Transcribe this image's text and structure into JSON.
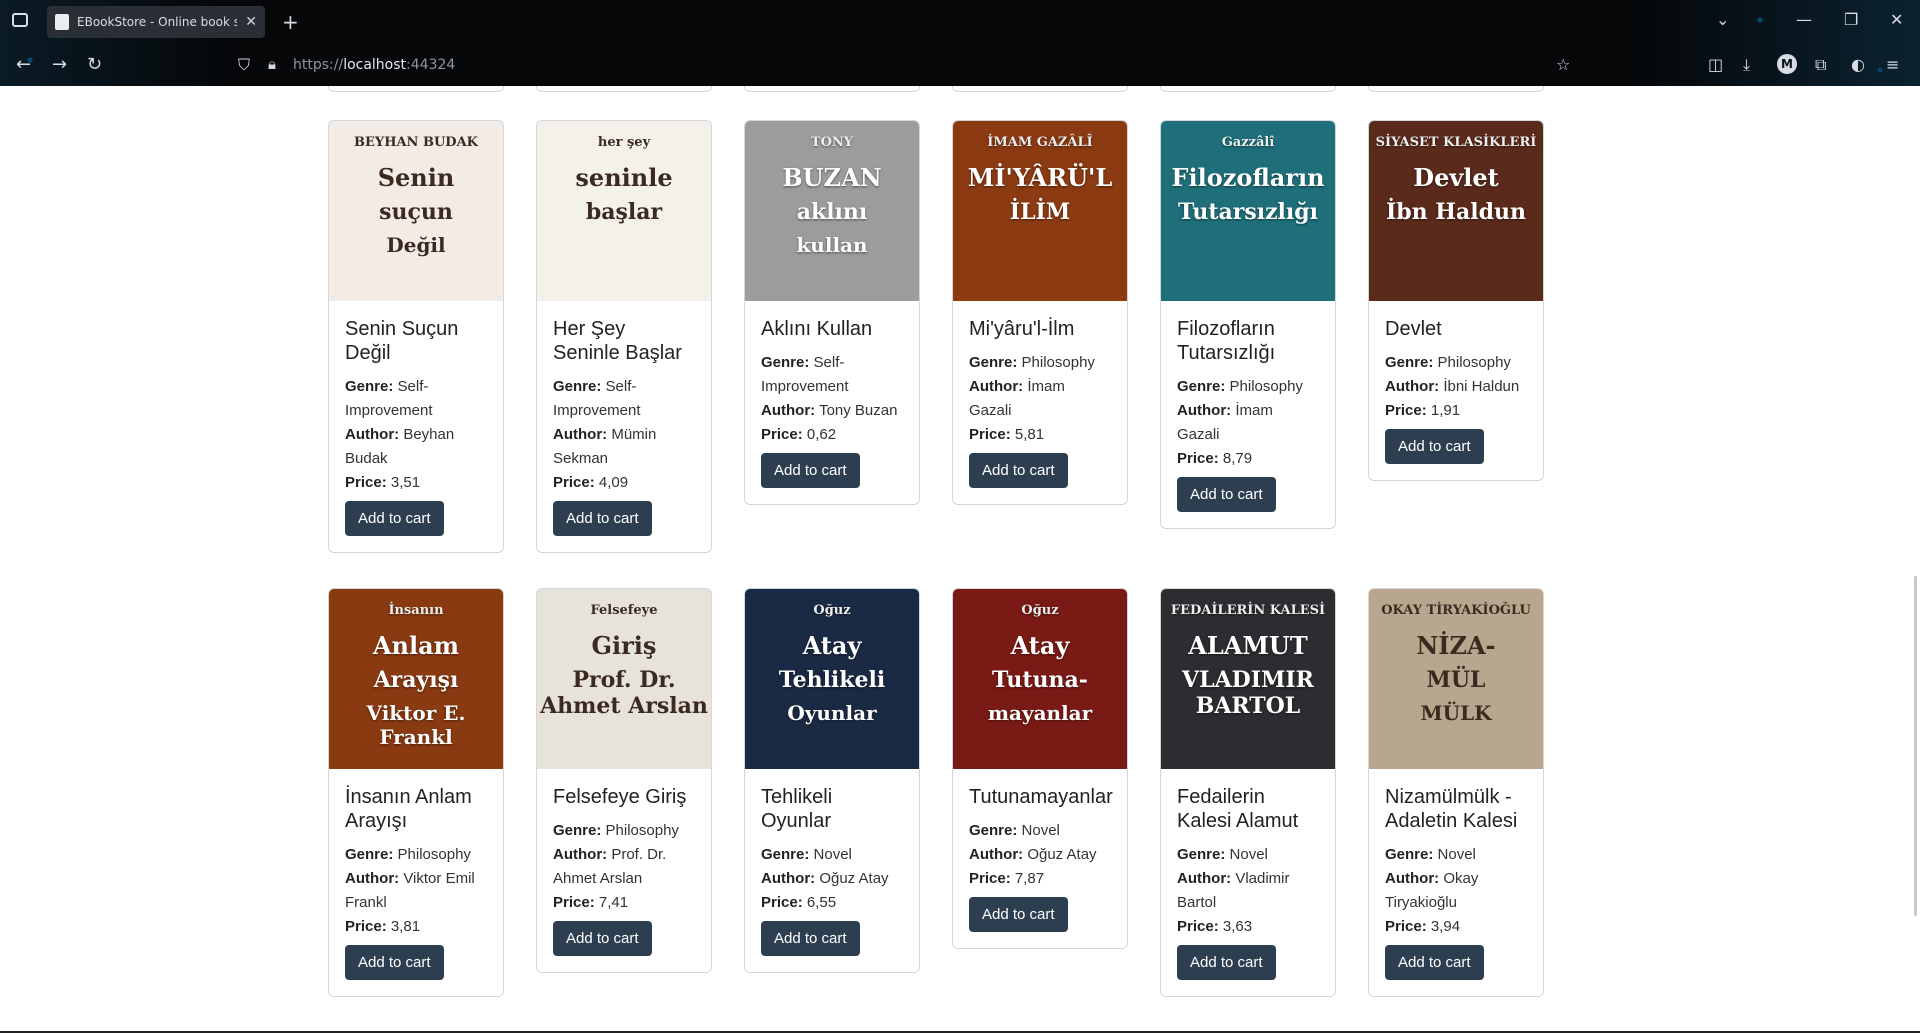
{
  "browser": {
    "tab_title": "EBookStore - Online book store",
    "url_prefix": "https://",
    "url_host": "localhost",
    "url_port": ":44324"
  },
  "books": [
    {
      "title": "Senin Suçun Değil",
      "genre": "Self-Improvement",
      "author": "Beyhan Budak",
      "price": "3,51",
      "cover": {
        "bg": "#f3ece6",
        "line1": "BEYHAN BUDAK",
        "line2": "Senin",
        "line3": "suçun",
        "line4": "Değil"
      }
    },
    {
      "title": "Her Şey Seninle Başlar",
      "genre": "Self-Improvement",
      "author": "Mümin Sekman",
      "price": "4,09",
      "cover": {
        "bg": "#f4f1ea",
        "line1": "her şey",
        "line2": "seninle",
        "line3": "başlar"
      }
    },
    {
      "title": "Aklını Kullan",
      "genre": "Self-Improvement",
      "author": "Tony Buzan",
      "price": "0,62",
      "cover": {
        "bg": "#9c9c9c",
        "line1": "TONY",
        "line2": "BUZAN",
        "line3": "aklını",
        "line4": "kullan"
      }
    },
    {
      "title": "Mi'yâru'l-İlm",
      "genre": "Philosophy",
      "author": "İmam Gazali",
      "price": "5,81",
      "cover": {
        "bg": "#8b3a12",
        "line1": "İMAM GAZÂLÎ",
        "line2": "Mİ'YÂRÜ'L",
        "line3": "İLİM"
      }
    },
    {
      "title": "Filozofların Tutarsızlığı",
      "genre": "Philosophy",
      "author": "İmam Gazali",
      "price": "8,79",
      "cover": {
        "bg": "#1e6f7a",
        "line1": "Gazzâlî",
        "line2": "Filozofların",
        "line3": "Tutarsızlığı"
      }
    },
    {
      "title": "Devlet",
      "genre": "Philosophy",
      "author": "İbni Haldun",
      "price": "1,91",
      "cover": {
        "bg": "#5a2a1a",
        "line1": "SİYASET KLASİKLERİ",
        "line2": "Devlet",
        "line3": "İbn Haldun"
      }
    },
    {
      "title": "İnsanın Anlam Arayışı",
      "genre": "Philosophy",
      "author": "Viktor Emil Frankl",
      "price": "3,81",
      "cover": {
        "bg": "#8a3a10",
        "line1": "İnsanın",
        "line2": "Anlam",
        "line3": "Arayışı",
        "line4": "Viktor E. Frankl"
      }
    },
    {
      "title": "Felsefeye Giriş",
      "genre": "Philosophy",
      "author": "Prof. Dr. Ahmet Arslan",
      "price": "7,41",
      "cover": {
        "bg": "#e8e2dc",
        "line1": "Felsefeye",
        "line2": "Giriş",
        "line3": "Prof. Dr. Ahmet Arslan"
      }
    },
    {
      "title": "Tehlikeli Oyunlar",
      "genre": "Novel",
      "author": "Oğuz Atay",
      "price": "6,55",
      "cover": {
        "bg": "#1b2a44",
        "line1": "Oğuz",
        "line2": "Atay",
        "line3": "Tehlikeli",
        "line4": "Oyunlar"
      }
    },
    {
      "title": "Tutunamayanlar",
      "genre": "Novel",
      "author": "Oğuz Atay",
      "price": "7,87",
      "cover": {
        "bg": "#7a1a14",
        "line1": "Oğuz",
        "line2": "Atay",
        "line3": "Tutuna-",
        "line4": "mayanlar"
      }
    },
    {
      "title": "Fedailerin Kalesi Alamut",
      "genre": "Novel",
      "author": "Vladimir Bartol",
      "price": "3,63",
      "cover": {
        "bg": "#2b2d30",
        "line1": "FEDAİLERİN KALESİ",
        "line2": "ALAMUT",
        "line3": "VLADIMIR BARTOL"
      }
    },
    {
      "title": "Nizamülmülk - Adaletin Kalesi",
      "genre": "Novel",
      "author": "Okay Tiryakioğlu",
      "price": "3,94",
      "cover": {
        "bg": "#b8a78e",
        "line1": "OKAY TİRYAKİOĞLU",
        "line2": "NİZA-",
        "line3": "MÜL",
        "line4": "MÜLK"
      }
    }
  ],
  "labels": {
    "genre": "Genre:",
    "author": "Author:",
    "price": "Price:",
    "add_to_cart": "Add to cart"
  },
  "colors": {
    "button": "#2c3e50",
    "border": "#d3d6da"
  }
}
